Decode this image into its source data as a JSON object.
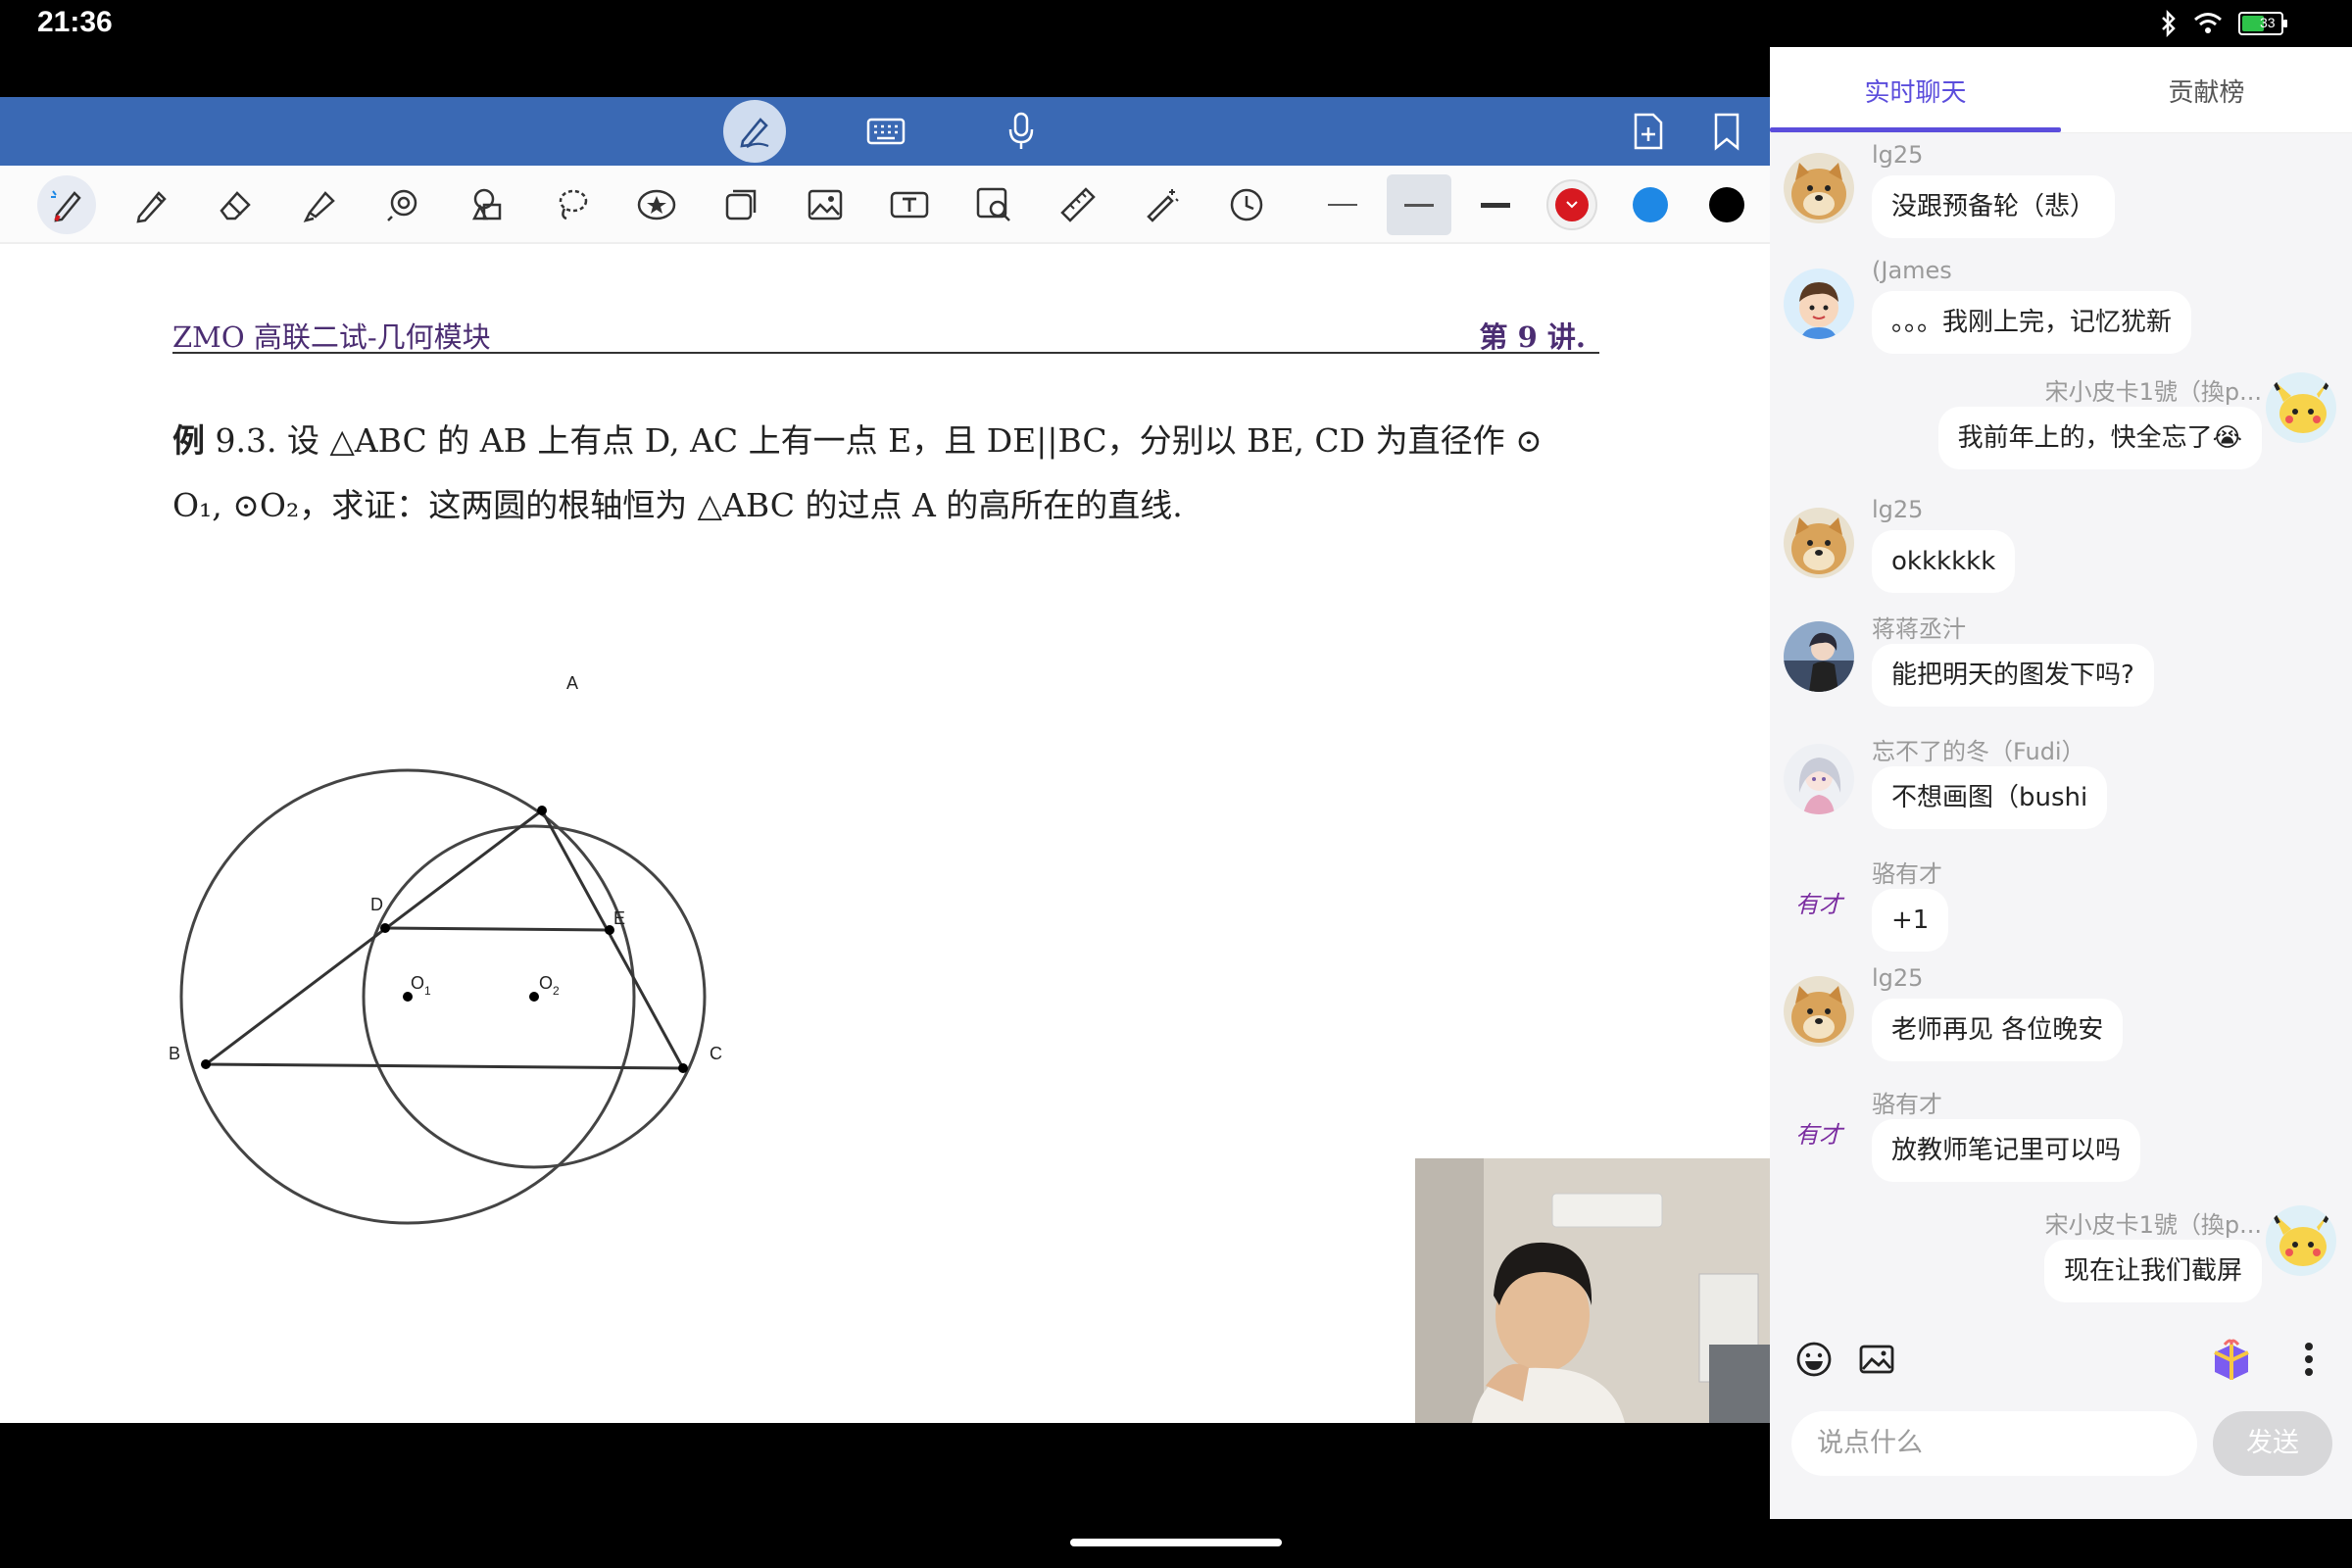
{
  "status_bar": {
    "time": "21:36",
    "battery": "33"
  },
  "document": {
    "header_left": "ZMO 高联二试-几何模块",
    "header_right": "第 9 讲.",
    "problem_label": "例",
    "problem_line1": " 9.3. 设 △ABC 的 AB 上有点 D, AC 上有一点 E，且 DE||BC，分别以 BE, CD 为直径作 ⊙",
    "problem_line2": "O₁, ⊙O₂，求证：这两圆的根轴恒为 △ABC 的过点 A 的高所在的直线.",
    "figure_labels": {
      "A": "A",
      "B": "B",
      "C": "C",
      "D": "D",
      "E": "E",
      "O1": "O",
      "O1_sub": "1",
      "O2": "O",
      "O2_sub": "2"
    }
  },
  "toolbar": {
    "colors": {
      "red": "#d71920",
      "blue": "#1e88e5",
      "black": "#000000"
    }
  },
  "chat": {
    "tabs": [
      {
        "label": "实时聊天"
      },
      {
        "label": "贡献榜"
      }
    ],
    "messages": [
      {
        "sender": "lg25",
        "text": "没跟预备轮（悲）",
        "avatar": "doge-avatar",
        "self": false
      },
      {
        "sender": "(James",
        "text": "。。。我刚上完，记忆犹新",
        "avatar": "cartoon-boy-avatar",
        "self": false
      },
      {
        "sender": "宋小皮卡1號（換p...",
        "text": "我前年上的，快全忘了😭",
        "avatar": "pikachu-avatar",
        "self": true
      },
      {
        "sender": "lg25",
        "text": "okkkkkk",
        "avatar": "doge-avatar",
        "self": false
      },
      {
        "sender": "蒋蒋丞汁",
        "text": "能把明天的图发下吗?",
        "avatar": "anime-avatar",
        "self": false
      },
      {
        "sender": "忘不了的冬（Fudi）",
        "text": "不想画图（bushi",
        "avatar": "anime-girl-avatar",
        "self": false
      },
      {
        "sender": "骆有才",
        "text": "+1",
        "avatar": "calligraphy-avatar",
        "avatar_text": "有才",
        "self": false
      },
      {
        "sender": "lg25",
        "text": "老师再见 各位晚安",
        "avatar": "doge-avatar",
        "self": false
      },
      {
        "sender": "骆有才",
        "text": "放教师笔记里可以吗",
        "avatar": "calligraphy-avatar",
        "avatar_text": "有才",
        "self": false
      },
      {
        "sender": "宋小皮卡1號（換p...",
        "text": "现在让我们截屏",
        "avatar": "pikachu-avatar",
        "self": true
      }
    ],
    "input_placeholder": "说点什么",
    "send_label": "发送",
    "accent": "#5b4ddc"
  }
}
